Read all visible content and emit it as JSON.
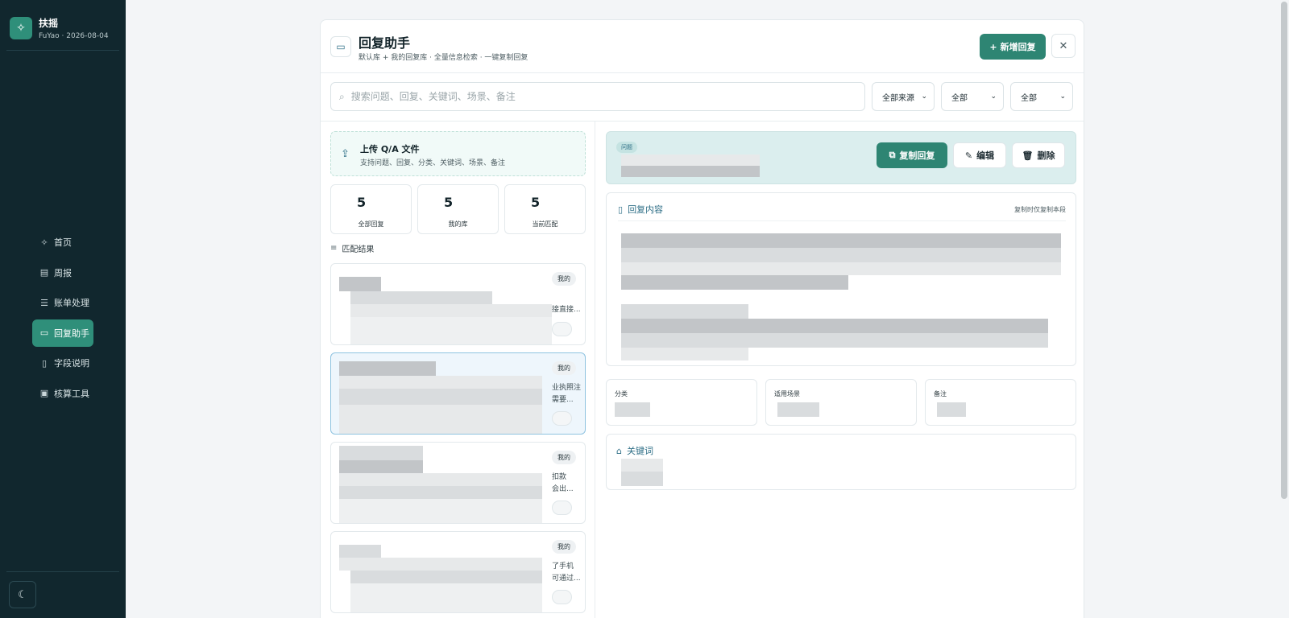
{
  "app": {
    "name": "扶摇",
    "subtitle": "FuYao · 2026-08-04"
  },
  "sidebar": {
    "items": [
      {
        "label": "首页",
        "icon": "sparkle-icon",
        "glyph": "✧"
      },
      {
        "label": "周报",
        "icon": "document-icon",
        "glyph": "▤"
      },
      {
        "label": "账单处理",
        "icon": "database-icon",
        "glyph": "☰"
      },
      {
        "label": "回复助手",
        "icon": "chat-icon",
        "glyph": "▭",
        "active": true
      },
      {
        "label": "字段说明",
        "icon": "book-icon",
        "glyph": "▯"
      },
      {
        "label": "核算工具",
        "icon": "archive-icon",
        "glyph": "▣"
      }
    ],
    "theme_toggle_icon": "moon-icon"
  },
  "modal": {
    "title": "回复助手",
    "subtitle": "默认库 + 我的回复库 · 全量信息检索 · 一键复制回复",
    "add_button": "新增回复",
    "close_icon": "close-icon"
  },
  "search": {
    "placeholder": "搜索问题、回复、关键词、场景、备注",
    "value": "",
    "filters": [
      "全部来源",
      "全部",
      "全部"
    ]
  },
  "upload": {
    "title": "上传 Q/A 文件",
    "subtitle": "支持问题、回复、分类、关键词、场景、备注"
  },
  "stats": [
    {
      "value": "5",
      "label": "全部回复"
    },
    {
      "value": "5",
      "label": "我的库"
    },
    {
      "value": "5",
      "label": "当前匹配"
    }
  ],
  "results": {
    "heading": "匹配结果",
    "cards": [
      {
        "badge": "我的",
        "snippet": "接直接...",
        "snippet2": ""
      },
      {
        "badge": "我的",
        "snippet": "业执照注",
        "snippet2": "需要...",
        "selected": true
      },
      {
        "badge": "我的",
        "snippet": "扣款",
        "snippet2": "会出..."
      },
      {
        "badge": "我的",
        "snippet": "了手机",
        "snippet2": "可通过..."
      }
    ]
  },
  "detail": {
    "question_tag": "问题",
    "copy_button": "复制回复",
    "edit_button": "编辑",
    "delete_button": "删除",
    "reply_heading": "回复内容",
    "reply_note": "复制时仅复制本段",
    "meta": [
      {
        "label": "分类"
      },
      {
        "label": "适用场景"
      },
      {
        "label": "备注"
      }
    ],
    "keywords_heading": "关键词"
  },
  "colors": {
    "sidebar_bg": "#11272e",
    "accent": "#2e8573",
    "link": "#2f6f87"
  }
}
